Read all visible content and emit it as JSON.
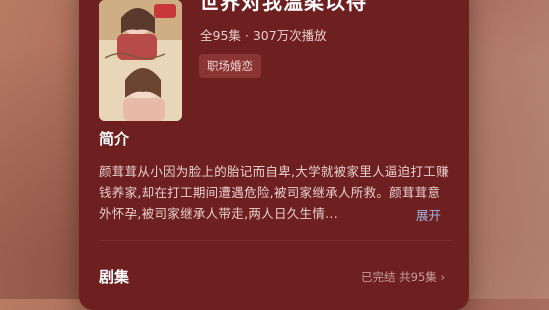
{
  "show": {
    "title": "世界对我温柔以待",
    "meta": "全95集 · 307万次播放",
    "tag": "职场婚恋"
  },
  "intro": {
    "heading": "简介",
    "text": "颜茸茸从小因为脸上的胎记而自卑,大学就被家里人逼迫打工赚钱养家,却在打工期间遭遇危险,被司家继承人所救。颜茸茸意外怀孕,被司家继承人带走,两人日久生情...",
    "expand_label": "展开"
  },
  "episodes": {
    "heading": "剧集",
    "status": "已完结 共95集 ›"
  },
  "colors": {
    "panel": "#6e1f20",
    "tag_bg": "#8a3434",
    "link": "#9fb3e3"
  },
  "icons": {
    "chevron": "chevron-right-icon"
  }
}
